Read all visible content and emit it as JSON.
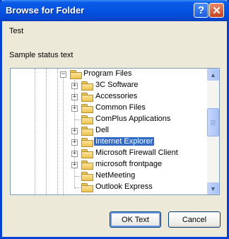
{
  "window": {
    "title": "Browse for Folder"
  },
  "titlebar_buttons": {
    "help": "?",
    "close": "✕"
  },
  "description": "Test",
  "status_text": "Sample status text",
  "tree": {
    "root_folder": "Program Files",
    "children": [
      {
        "label": "3C Software",
        "expandable": true
      },
      {
        "label": "Accessories",
        "expandable": true
      },
      {
        "label": "Common Files",
        "expandable": true
      },
      {
        "label": "ComPlus Applications",
        "expandable": false
      },
      {
        "label": "Dell",
        "expandable": true
      },
      {
        "label": "Internet Explorer",
        "expandable": true,
        "selected": true
      },
      {
        "label": "Microsoft Firewall Client",
        "expandable": true
      },
      {
        "label": "microsoft frontpage",
        "expandable": true
      },
      {
        "label": "NetMeeting",
        "expandable": false
      },
      {
        "label": "Outlook Express",
        "expandable": false
      }
    ]
  },
  "buttons": {
    "ok": "OK Text",
    "cancel": "Cancel"
  },
  "icons": {
    "folder": "folder-icon",
    "expand": "plus-icon",
    "collapse": "minus-icon",
    "scroll_up": "up-arrow-icon",
    "scroll_down": "down-arrow-icon"
  }
}
